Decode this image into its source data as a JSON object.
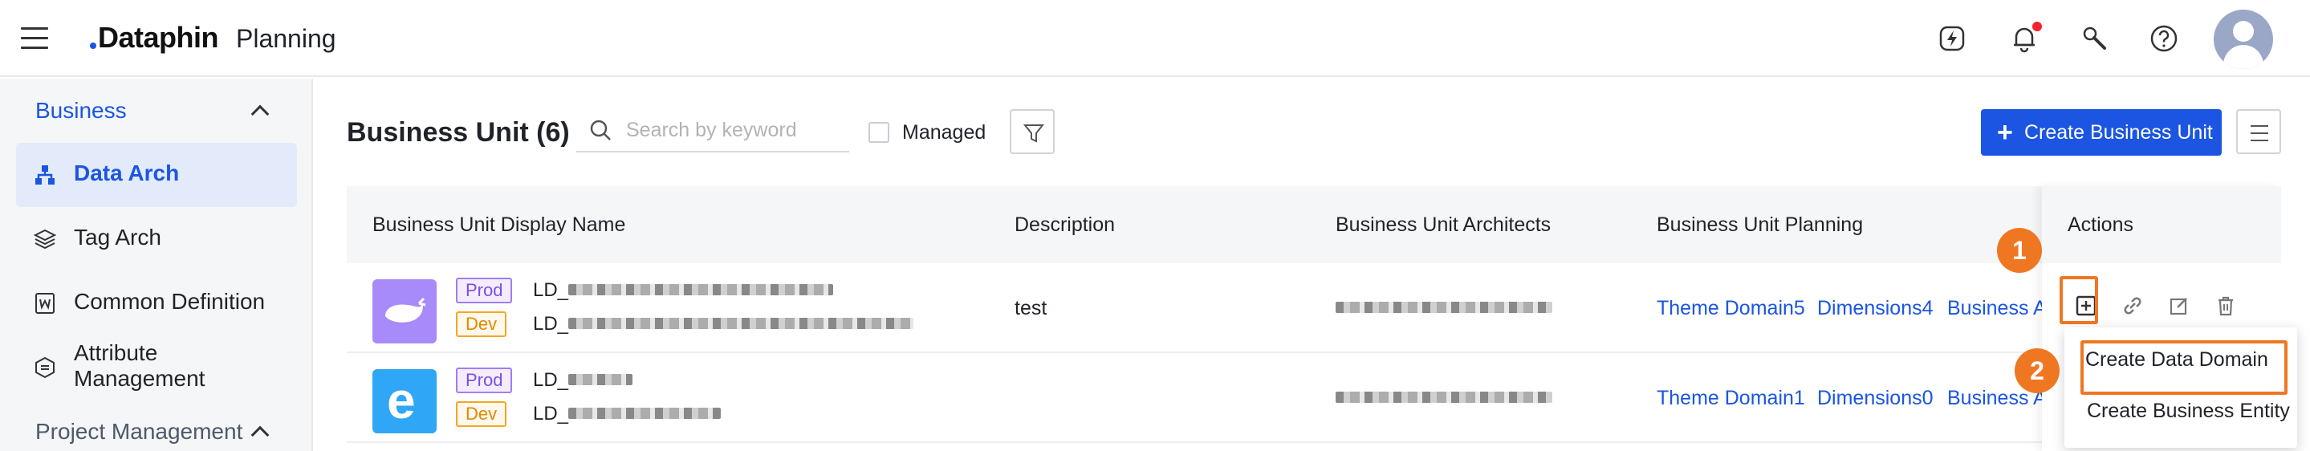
{
  "header": {
    "logo": "Dataphin",
    "app_name": "Planning",
    "icons": [
      "hamburger-icon",
      "lightning-icon",
      "bell-icon",
      "wrench-icon",
      "help-icon",
      "avatar"
    ]
  },
  "sidebar": {
    "group_business": "Business",
    "items": [
      {
        "label": "Data Arch",
        "icon": "hierarchy-icon",
        "selected": true
      },
      {
        "label": "Tag Arch",
        "icon": "layers-icon"
      },
      {
        "label": "Common Definition",
        "icon": "word-doc-icon"
      },
      {
        "label": "Attribute Management",
        "icon": "hexagon-list-icon"
      }
    ],
    "group_project": "Project Management"
  },
  "main": {
    "title": "Business Unit (6)",
    "search_placeholder": "Search by keyword",
    "managed_label": "Managed",
    "create_button": "Create Business Unit",
    "columns": [
      "Business Unit Display Name",
      "Description",
      "Business Unit Architects",
      "Business Unit Planning",
      "Actions"
    ],
    "rows": [
      {
        "thumb_color": "#a78bfa",
        "prod_badge": "Prod",
        "dev_badge": "Dev",
        "prod_name": "LD_",
        "dev_name": "LD_",
        "description": "test",
        "planning": [
          "Theme Domain5",
          "Dimensions4",
          "Business A"
        ]
      },
      {
        "thumb_color": "#2fa6f6",
        "thumb_letter": "e",
        "prod_badge": "Prod",
        "dev_badge": "Dev",
        "prod_name": "LD_",
        "dev_name": "LD_",
        "description": "",
        "planning": [
          "Theme Domain1",
          "Dimensions0",
          "Business A"
        ]
      }
    ]
  },
  "dropdown": {
    "items": [
      "Create Data Domain",
      "Create Business Entity"
    ]
  },
  "annotations": {
    "step1": "1",
    "step2": "2",
    "color": "#f07722"
  },
  "colors": {
    "accent": "#1b55e2",
    "prod": "#7c4ee4",
    "dev": "#e08a00"
  }
}
